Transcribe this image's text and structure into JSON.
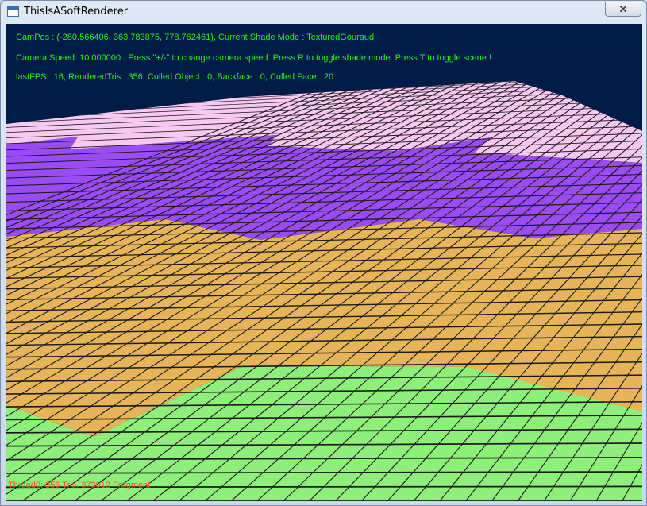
{
  "window": {
    "title": "ThisIsASoftRenderer",
    "close_glyph": "✕",
    "icon": "app-window-icon"
  },
  "hud": {
    "campos": "CamPos : (-280.566406, 363.783875, 778.762461), Current Shade Mode : TexturedGouraud",
    "camera_speed": "Camera Speed: 10.000000 . Press \"+/-\" to change camera speed. Press R to toggle shade mode. Press T to toggle scene !",
    "stats": "lastFPS : 16, RenderedTris : 356, Culled Object : 0, Backface : 0, Culled Face : 20",
    "thread_stats": "Thread0: 356 Tris,  373012 Fragment"
  },
  "colors": {
    "background": "#001c46",
    "hud_text": "#22ee22",
    "thread_text": "#ff4a1c",
    "terrain_pink": "#f7c8f0",
    "terrain_purple": "#9a4cf2",
    "terrain_orange": "#e7b45a",
    "terrain_green": "#8ef07a",
    "grid_line": "#1a1a1a"
  }
}
